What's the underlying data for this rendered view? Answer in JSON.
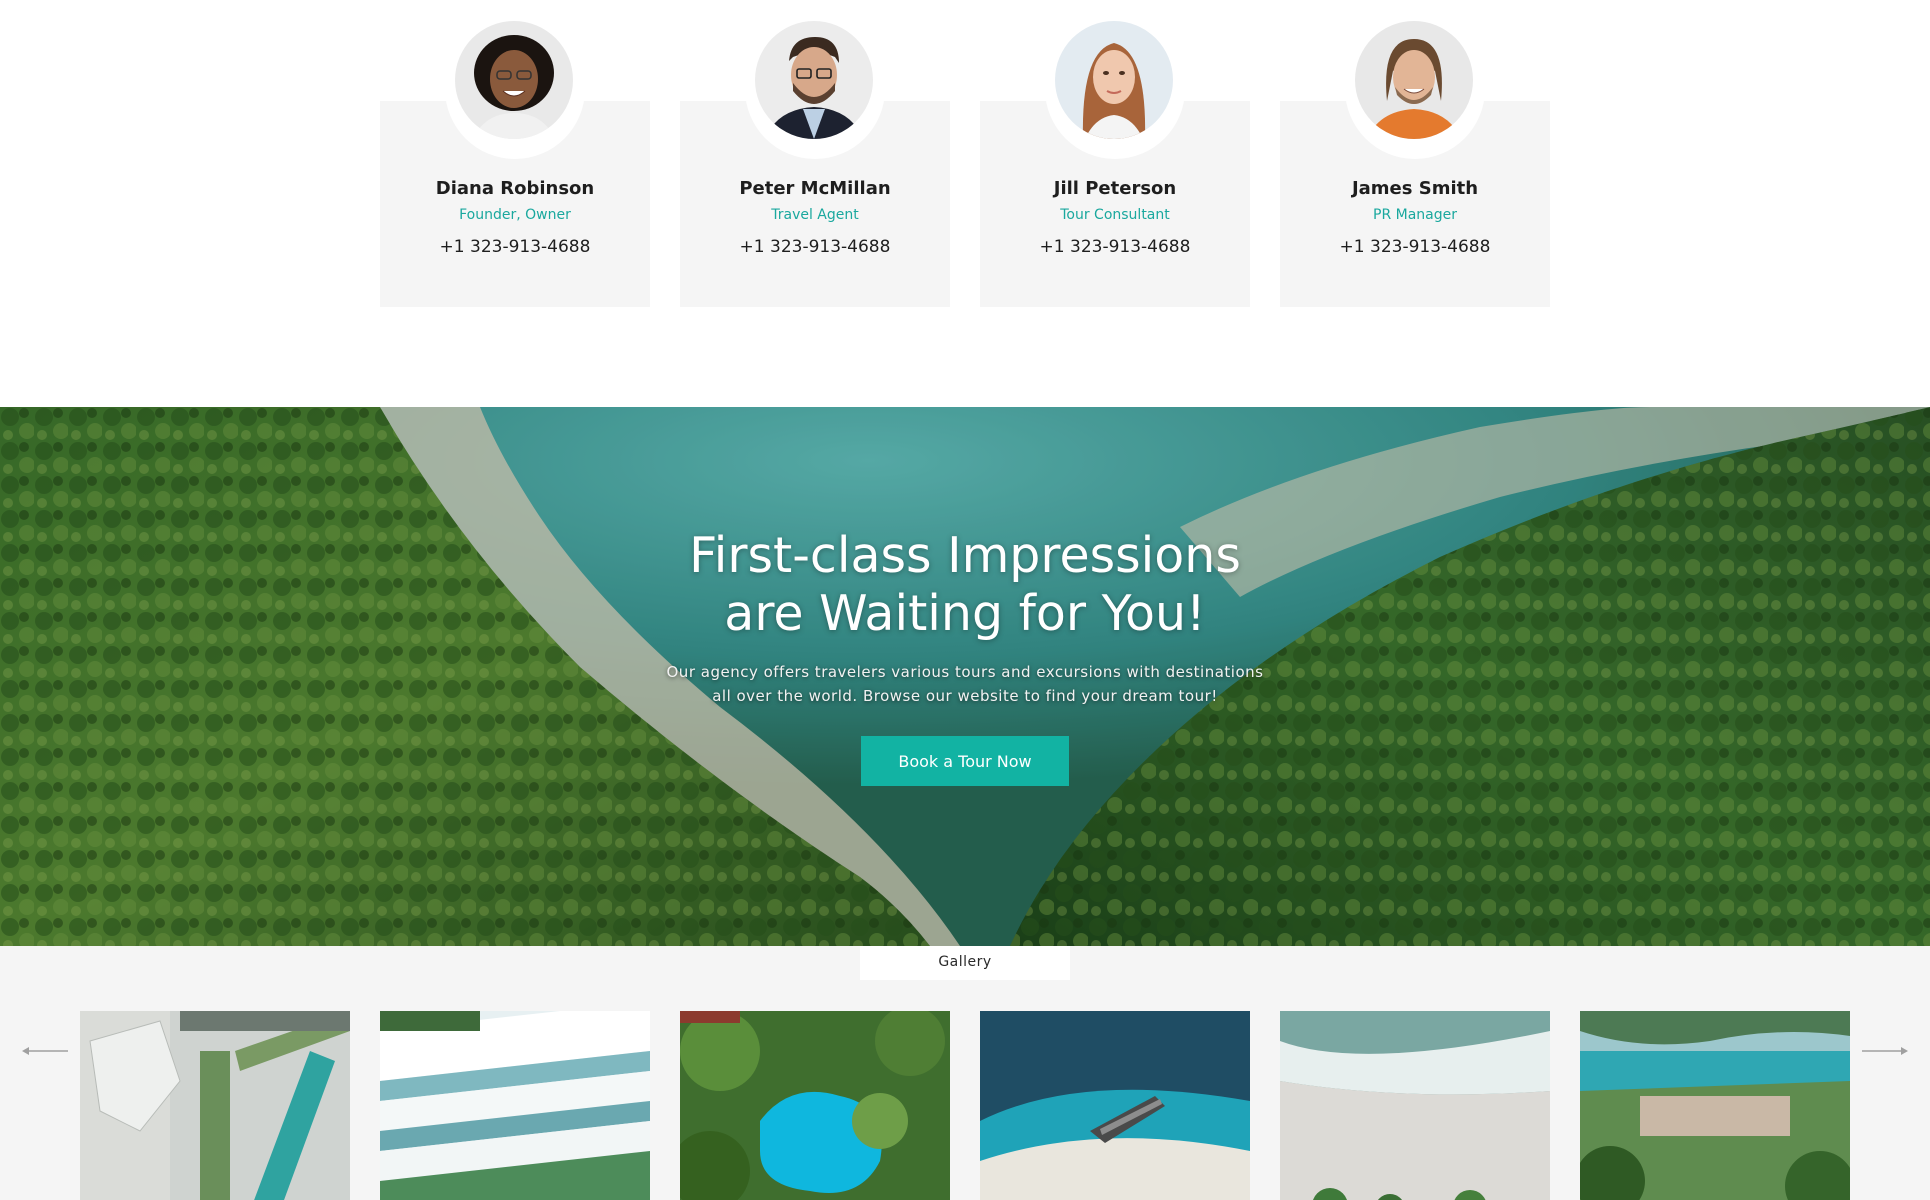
{
  "team": {
    "members": [
      {
        "name": "Diana Robinson",
        "role": "Founder, Owner",
        "phone": "+1 323-913-4688"
      },
      {
        "name": "Peter McMillan",
        "role": "Travel Agent",
        "phone": "+1 323-913-4688"
      },
      {
        "name": "Jill Peterson",
        "role": "Tour Consultant",
        "phone": "+1 323-913-4688"
      },
      {
        "name": "James Smith",
        "role": "PR Manager",
        "phone": "+1 323-913-4688"
      }
    ]
  },
  "hero": {
    "title_line1": "First-class Impressions",
    "title_line2": "are Waiting for You!",
    "text_line1": "Our agency offers travelers various tours and excursions with destinations",
    "text_line2": "all over the world. Browse our website to find your dream tour!",
    "button_label": "Book a Tour Now"
  },
  "gallery": {
    "tab_label": "Gallery",
    "prev_icon": "arrow-left-icon",
    "next_icon": "arrow-right-icon"
  },
  "colors": {
    "accent": "#12b3a3",
    "role_text": "#1aa89e",
    "card_bg": "#f5f5f5"
  }
}
